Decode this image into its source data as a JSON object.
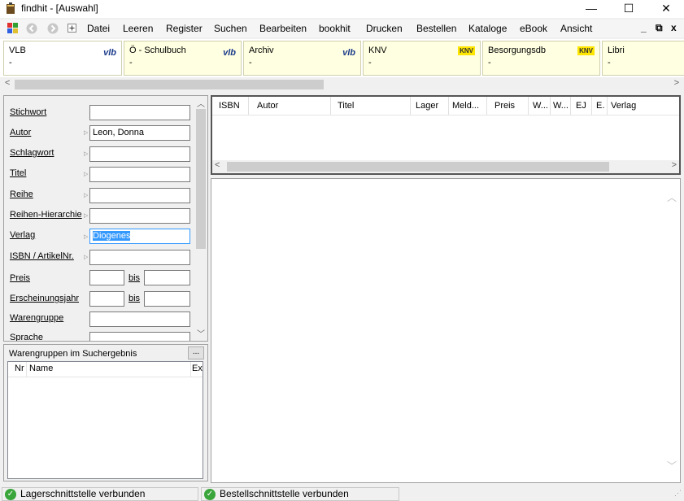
{
  "window": {
    "title": "findhit - [Auswahl]",
    "minimize": "—",
    "maximize": "☐",
    "close": "✕"
  },
  "menu": {
    "items": [
      "Datei",
      "Leeren",
      "Register",
      "Suchen",
      "Bearbeiten",
      "bookhit",
      "Drucken",
      "Bestellen",
      "Kataloge",
      "eBook",
      "Ansicht"
    ],
    "mdi_minimize": "_",
    "mdi_restore": "⧉",
    "mdi_close": "x"
  },
  "databases": [
    {
      "name": "VLB",
      "sub": "-",
      "logo": "vlb"
    },
    {
      "name": "Ö - Schulbuch",
      "sub": "-",
      "logo": "vlb"
    },
    {
      "name": "Archiv",
      "sub": "-",
      "logo": "vlb"
    },
    {
      "name": "KNV",
      "sub": "-",
      "logo": "KNV"
    },
    {
      "name": "Besorgungsdb",
      "sub": "-",
      "logo": "KNV"
    },
    {
      "name": "Libri",
      "sub": "-",
      "logo": ""
    }
  ],
  "search": {
    "fields": {
      "stichwort": {
        "label": "Stichwort",
        "value": ""
      },
      "autor": {
        "label": "Autor",
        "value": "Leon, Donna"
      },
      "schlagwort": {
        "label": "Schlagwort",
        "value": ""
      },
      "titel": {
        "label": "Titel",
        "value": ""
      },
      "reihe": {
        "label": "Reihe",
        "value": ""
      },
      "reihen_hierarchie": {
        "label": "Reihen-Hierarchie",
        "value": ""
      },
      "verlag": {
        "label": "Verlag",
        "value": "Diogenes"
      },
      "isbn": {
        "label": "ISBN / ArtikelNr.",
        "value": ""
      },
      "preis": {
        "label": "Preis",
        "from": "",
        "to": ""
      },
      "erscheinungsjahr": {
        "label": "Erscheinungsjahr",
        "from": "",
        "to": ""
      },
      "warengruppe": {
        "label": "Warengruppe",
        "value": ""
      },
      "sprache": {
        "label": "Sprache",
        "value": ""
      }
    },
    "bis_label": "bis"
  },
  "warengruppen": {
    "header": "Warengruppen im Suchergebnis",
    "more": "...",
    "columns": [
      "Nr",
      "Name",
      "Ex"
    ]
  },
  "results": {
    "columns": [
      "ISBN",
      "Autor",
      "Titel",
      "Lager",
      "Meld...",
      "Preis",
      "W...",
      "W...",
      "EJ",
      "E.",
      "Verlag"
    ]
  },
  "status": [
    {
      "text": "Lagerschnittstelle verbunden"
    },
    {
      "text": "Bestellschnittstelle verbunden"
    }
  ]
}
